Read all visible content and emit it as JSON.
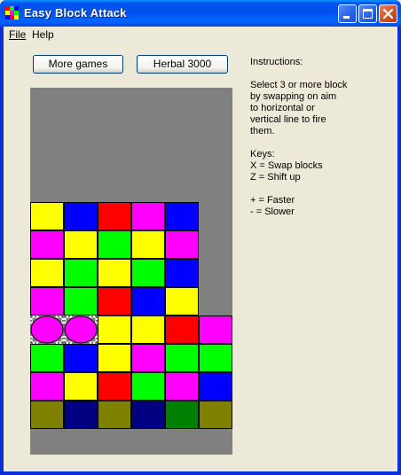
{
  "window": {
    "title": "Easy Block Attack",
    "controls": [
      "minimize",
      "maximize",
      "close"
    ]
  },
  "menu": {
    "file": {
      "label": "File",
      "mnemonic": "F"
    },
    "help": {
      "label": "Help"
    }
  },
  "buttons": {
    "more_games": "More games",
    "herbal": "Herbal 3000"
  },
  "instructions": {
    "heading": "Instructions:",
    "body": "Select 3 or more block\nby swapping on aim\nto horizontal or\nvertical line to fire\nthem.",
    "keys": "Keys:\nX = Swap blocks\nZ = Shift up",
    "speed": "+ = Faster\n- = Slower"
  },
  "colors": {
    "yellow": "#ffff00",
    "blue": "#0000ff",
    "red": "#ff0000",
    "magenta": "#ff00ff",
    "green": "#00ff00",
    "olive": "#808000",
    "navy": "#000080",
    "darkgreen": "#008000",
    "empty": "#808080"
  },
  "board": {
    "columns": 6,
    "rows": 8,
    "grid": [
      [
        "yellow",
        "blue",
        "red",
        "magenta",
        "blue",
        null
      ],
      [
        "magenta",
        "yellow",
        "green",
        "yellow",
        "magenta",
        null
      ],
      [
        "yellow",
        "green",
        "yellow",
        "green",
        "blue",
        null
      ],
      [
        "magenta",
        "green",
        "red",
        "blue",
        "yellow",
        null
      ],
      [
        "magenta",
        "magenta",
        "yellow",
        "yellow",
        "red",
        "magenta"
      ],
      [
        "green",
        "blue",
        "yellow",
        "magenta",
        "green",
        "green"
      ],
      [
        "magenta",
        "yellow",
        "red",
        "green",
        "magenta",
        "blue"
      ],
      [
        "olive",
        "navy",
        "olive",
        "navy",
        "darkgreen",
        "olive"
      ]
    ],
    "cursor": {
      "row": 4,
      "columns": [
        0,
        1
      ]
    },
    "incoming_row": 7
  }
}
